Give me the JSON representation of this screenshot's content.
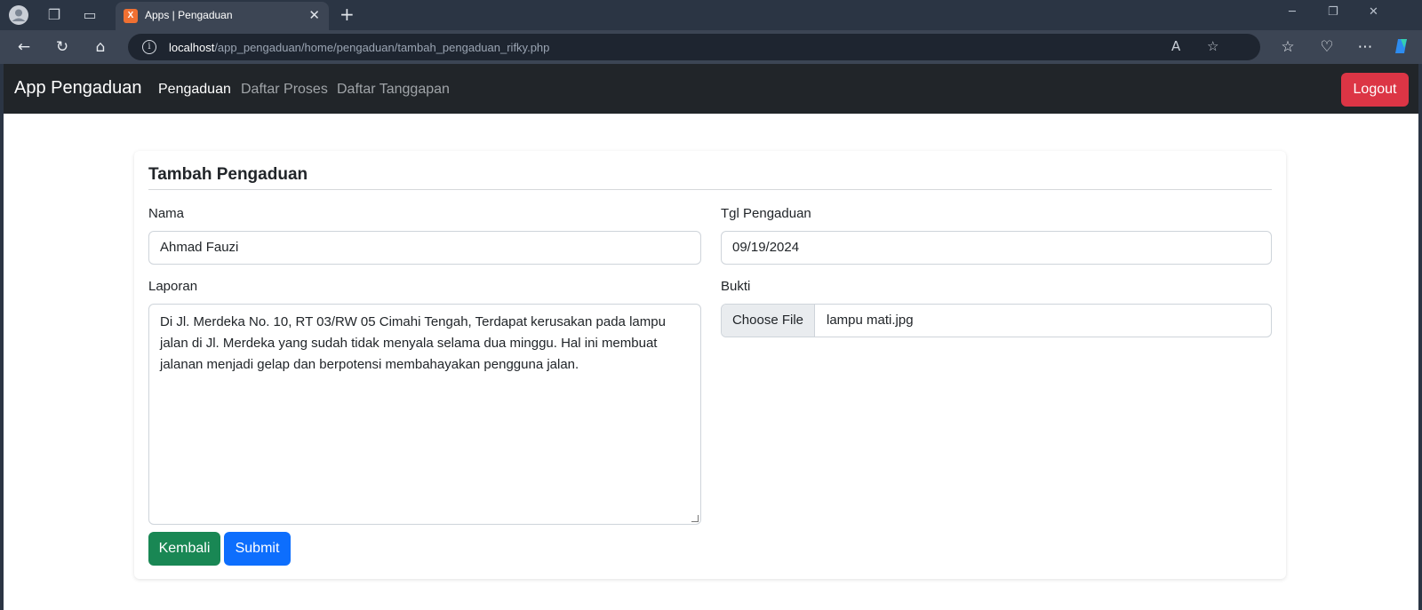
{
  "browser": {
    "tab_title": "Apps | Pengaduan",
    "tab_favicon_letter": "X",
    "url_host": "localhost",
    "url_path": "/app_pengaduan/home/pengaduan/tambah_pengaduan_rifky.php"
  },
  "navbar": {
    "brand": "App Pengaduan",
    "links": [
      "Pengaduan",
      "Daftar Proses",
      "Daftar Tanggapan"
    ],
    "logout_label": "Logout"
  },
  "form": {
    "title": "Tambah Pengaduan",
    "nama_label": "Nama",
    "nama_value": "Ahmad Fauzi",
    "tgl_label": "Tgl Pengaduan",
    "tgl_value": "09/19/2024",
    "laporan_label": "Laporan",
    "laporan_lines": [
      "Di Jl. Merdeka No. 10, RT 03/RW 05 Cimahi Tengah, Terdapat kerusakan pada lampu",
      "jalan di Jl. Merdeka yang sudah tidak menyala selama dua minggu. Hal ini membuat",
      "jalanan menjadi gelap dan berpotensi membahayakan pengguna jalan."
    ],
    "bukti_label": "Bukti",
    "file_button_label": "Choose File",
    "file_name": "lampu mati.jpg",
    "kembali_label": "Kembali",
    "submit_label": "Submit"
  },
  "colors": {
    "navbar_bg": "#212529",
    "logout": "#dc3545",
    "kembali": "#198754",
    "submit": "#0d6efd"
  }
}
